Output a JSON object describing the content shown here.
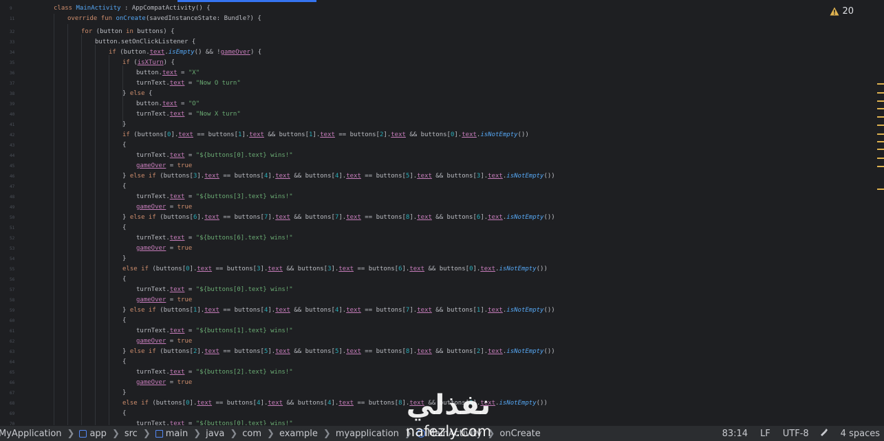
{
  "editor": {
    "line_numbers": [
      "9",
      "11",
      "32",
      "33",
      "34",
      "35",
      "36",
      "37",
      "38",
      "39",
      "40",
      "41",
      "42",
      "43",
      "44",
      "45",
      "46",
      "47",
      "48",
      "49",
      "50",
      "51",
      "52",
      "53",
      "54",
      "55",
      "56",
      "57",
      "58",
      "59",
      "60",
      "61",
      "62",
      "63",
      "64",
      "65",
      "66",
      "67",
      "68",
      "69",
      "70"
    ],
    "warning_count": "20"
  },
  "code": {
    "l9": [
      "class ",
      "MainActivity",
      " : ",
      "AppCompatActivity",
      "() {"
    ],
    "l11": [
      "override fun ",
      "onCreate",
      "(savedInstanceState: Bundle?) {"
    ],
    "l32": [
      "for",
      " (button ",
      "in",
      " buttons) {"
    ],
    "l33": [
      "button.setOnClickListener {"
    ],
    "l34": [
      "if",
      " (button.",
      "text",
      ".",
      "isEmpty",
      "() && !",
      "gameOver",
      ") {"
    ],
    "l35": [
      "if",
      " (",
      "isXTurn",
      ") {"
    ],
    "l36": [
      "button.",
      "text",
      " = ",
      "\"X\""
    ],
    "l37": [
      "turnText.",
      "text",
      " = ",
      "\"Now O turn\""
    ],
    "l38": [
      "} ",
      "else",
      " {"
    ],
    "l39": [
      "button.",
      "text",
      " = ",
      "\"O\""
    ],
    "l40": [
      "turnText.",
      "text",
      " = ",
      "\"Now X turn\""
    ],
    "l41": [
      "}"
    ],
    "l42": [
      "if",
      " (buttons[",
      "0",
      "].",
      "text",
      " == buttons[",
      "1",
      "].",
      "text",
      " && buttons[",
      "1",
      "].",
      "text",
      " == buttons[",
      "2",
      "].",
      "text",
      " && buttons[",
      "0",
      "].",
      "text",
      ".",
      "isNotEmpty",
      "())"
    ],
    "l43": [
      "{"
    ],
    "l44": [
      "turnText.",
      "text",
      " = ",
      "\"${buttons[0].text} wins!\""
    ],
    "l45": [
      "gameOver",
      " = ",
      "true"
    ],
    "l46": [
      "} ",
      "else if",
      " (buttons[",
      "3",
      "].",
      "text",
      " == buttons[",
      "4",
      "].",
      "text",
      " && buttons[",
      "4",
      "].",
      "text",
      " == buttons[",
      "5",
      "].",
      "text",
      " && buttons[",
      "3",
      "].",
      "text",
      ".",
      "isNotEmpty",
      "())"
    ],
    "l47": [
      "{"
    ],
    "l48": [
      "turnText.",
      "text",
      " = ",
      "\"${buttons[3].text} wins!\""
    ],
    "l49": [
      "gameOver",
      " = ",
      "true"
    ],
    "l50": [
      "} ",
      "else if",
      " (buttons[",
      "6",
      "].",
      "text",
      " == buttons[",
      "7",
      "].",
      "text",
      " && buttons[",
      "7",
      "].",
      "text",
      " == buttons[",
      "8",
      "].",
      "text",
      " && buttons[",
      "6",
      "].",
      "text",
      ".",
      "isNotEmpty",
      "())"
    ],
    "l51": [
      "{"
    ],
    "l52": [
      "turnText.",
      "text",
      " = ",
      "\"${buttons[6].text} wins!\""
    ],
    "l53": [
      "gameOver",
      " = ",
      "true"
    ],
    "l54": [
      "}"
    ],
    "l55": [
      "else if",
      " (buttons[",
      "0",
      "].",
      "text",
      " == buttons[",
      "3",
      "].",
      "text",
      " && buttons[",
      "3",
      "].",
      "text",
      " == buttons[",
      "6",
      "].",
      "text",
      " && buttons[",
      "0",
      "].",
      "text",
      ".",
      "isNotEmpty",
      "())"
    ],
    "l56": [
      "{"
    ],
    "l57": [
      "turnText.",
      "text",
      " = ",
      "\"${buttons[0].text} wins!\""
    ],
    "l58": [
      "gameOver",
      " = ",
      "true"
    ],
    "l59": [
      "} ",
      "else if",
      " (buttons[",
      "1",
      "].",
      "text",
      " == buttons[",
      "4",
      "].",
      "text",
      " && buttons[",
      "4",
      "].",
      "text",
      " == buttons[",
      "7",
      "].",
      "text",
      " && buttons[",
      "1",
      "].",
      "text",
      ".",
      "isNotEmpty",
      "())"
    ],
    "l60": [
      "{"
    ],
    "l61": [
      "turnText.",
      "text",
      " = ",
      "\"${buttons[1].text} wins!\""
    ],
    "l62": [
      "gameOver",
      " = ",
      "true"
    ],
    "l63": [
      "} ",
      "else if",
      " (buttons[",
      "2",
      "].",
      "text",
      " == buttons[",
      "5",
      "].",
      "text",
      " && buttons[",
      "5",
      "].",
      "text",
      " == buttons[",
      "8",
      "].",
      "text",
      " && buttons[",
      "2",
      "].",
      "text",
      ".",
      "isNotEmpty",
      "())"
    ],
    "l64": [
      "{"
    ],
    "l65": [
      "turnText.",
      "text",
      " = ",
      "\"${buttons[2].text} wins!\""
    ],
    "l66": [
      "gameOver",
      " = ",
      "true"
    ],
    "l67": [
      "}"
    ],
    "l68": [
      "else if",
      " (buttons[",
      "0",
      "].",
      "text",
      " == buttons[",
      "4",
      "].",
      "text",
      " && buttons[",
      "4",
      "].",
      "text",
      " == buttons[",
      "8",
      "].",
      "text",
      " && buttons[",
      "0",
      "].",
      "text",
      ".",
      "isNotEmpty",
      "())"
    ],
    "l69": [
      "{"
    ],
    "l70": [
      "turnText.",
      "text",
      " = ",
      "\"${buttons[0].text} wins!\""
    ]
  },
  "statusbar": {
    "breadcrumbs": [
      "MyApplication",
      "app",
      "src",
      "main",
      "java",
      "com",
      "example",
      "myapplication",
      "MainActivity",
      "onCreate"
    ],
    "cursor_position": "83:14",
    "line_separator": "LF",
    "encoding": "UTF-8",
    "indent": "4 spaces"
  },
  "watermark": {
    "arabic_text": "نفذلي",
    "latin_text": "nafezly.com"
  },
  "colors": {
    "background": "#1e1f22",
    "keyword": "#cf8e6d",
    "function": "#56a8f5",
    "property": "#c77dbb",
    "string": "#6aab73",
    "number": "#2aacb8",
    "warning": "#e0b350"
  }
}
